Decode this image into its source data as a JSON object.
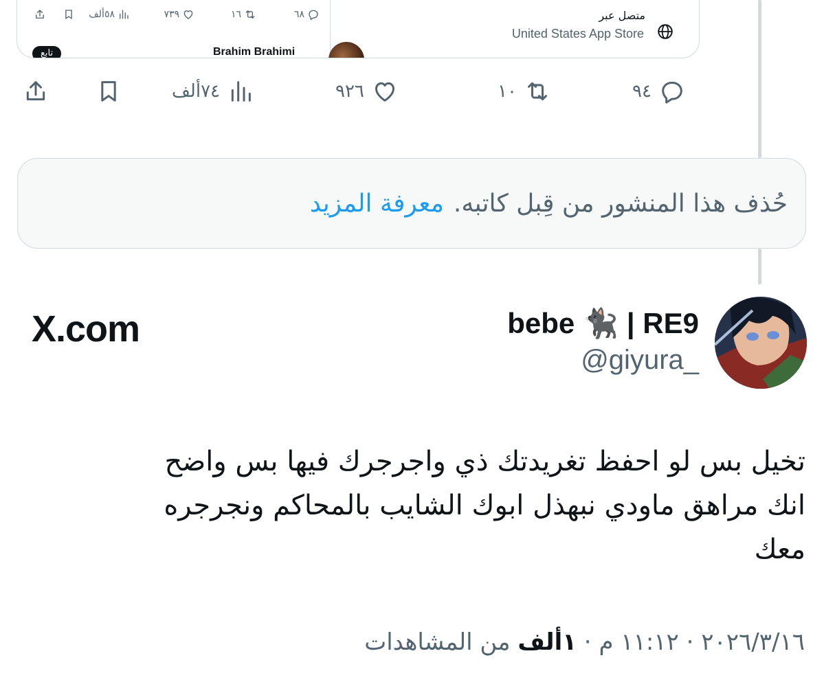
{
  "quoted": {
    "actions": {
      "replies": "٦٨",
      "retweets": "١٦",
      "likes": "٧٣٩",
      "views": "٥٨ألف"
    },
    "author_name": "Brahim Brahimi",
    "follow_label": "تابع",
    "source_line1": "متصل عبر",
    "source_line2": "United States App Store"
  },
  "actions": {
    "replies": "٩٤",
    "retweets": "١٠",
    "likes": "٩٢٦",
    "views": "٧٤ألف"
  },
  "deleted_notice": {
    "text": "حُذف هذا المنشور من قِبل كاتبه.",
    "learn_more": "معرفة المزيد"
  },
  "author": {
    "display_name": "bebe 🐈‍⬛ | RE9",
    "handle": "@giyura_"
  },
  "brand": "X.com",
  "tweet": {
    "lines": [
      "تخيل بس لو احفظ تغريدتك ذي واجرجرك فيها بس واضح",
      "انك مراهق ماودي نبهذل ابوك الشايب بالمحاكم ونجرجره",
      "معك"
    ]
  },
  "meta": {
    "date": "٢٠٢٦/٣/١٦",
    "sep": " · ",
    "time": "١١:١٢ م",
    "views_count": "١ألف",
    "views_label": "من المشاهدات"
  },
  "colors": {
    "text": "#0f1419",
    "secondary": "#536471",
    "link": "#1d9bf0",
    "border": "#cfd9de",
    "notice_bg": "#f7f9f9"
  }
}
